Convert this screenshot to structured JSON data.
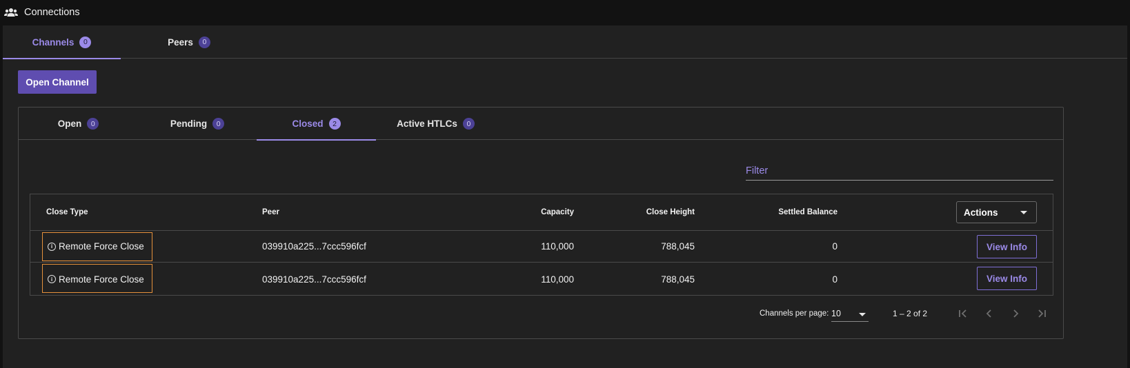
{
  "header": {
    "title": "Connections",
    "icon": "group-icon"
  },
  "top_tabs": [
    {
      "label": "Channels",
      "count": "0",
      "active": true
    },
    {
      "label": "Peers",
      "count": "0",
      "active": false
    }
  ],
  "open_channel_label": "Open Channel",
  "sub_tabs": [
    {
      "label": "Open",
      "count": "0",
      "active": false
    },
    {
      "label": "Pending",
      "count": "0",
      "active": false
    },
    {
      "label": "Closed",
      "count": "2",
      "active": true
    },
    {
      "label": "Active HTLCs",
      "count": "0",
      "active": false
    }
  ],
  "filter": {
    "placeholder": "Filter",
    "value": ""
  },
  "table": {
    "columns": [
      "Close Type",
      "Peer",
      "Capacity",
      "Close Height",
      "Settled Balance"
    ],
    "actions_label": "Actions",
    "view_label": "View Info",
    "rows": [
      {
        "close_type": "Remote Force Close",
        "peer": "039910a225...7ccc596fcf",
        "capacity": "110,000",
        "close_height": "788,045",
        "settled_balance": "0"
      },
      {
        "close_type": "Remote Force Close",
        "peer": "039910a225...7ccc596fcf",
        "capacity": "110,000",
        "close_height": "788,045",
        "settled_balance": "0"
      }
    ]
  },
  "paginator": {
    "label": "Channels per page:",
    "page_size": "10",
    "range": "1 – 2 of 2"
  },
  "colors": {
    "accent": "#9b8ae8",
    "button": "#5f4db0",
    "highlight": "#e6913b",
    "background": "#212121"
  }
}
